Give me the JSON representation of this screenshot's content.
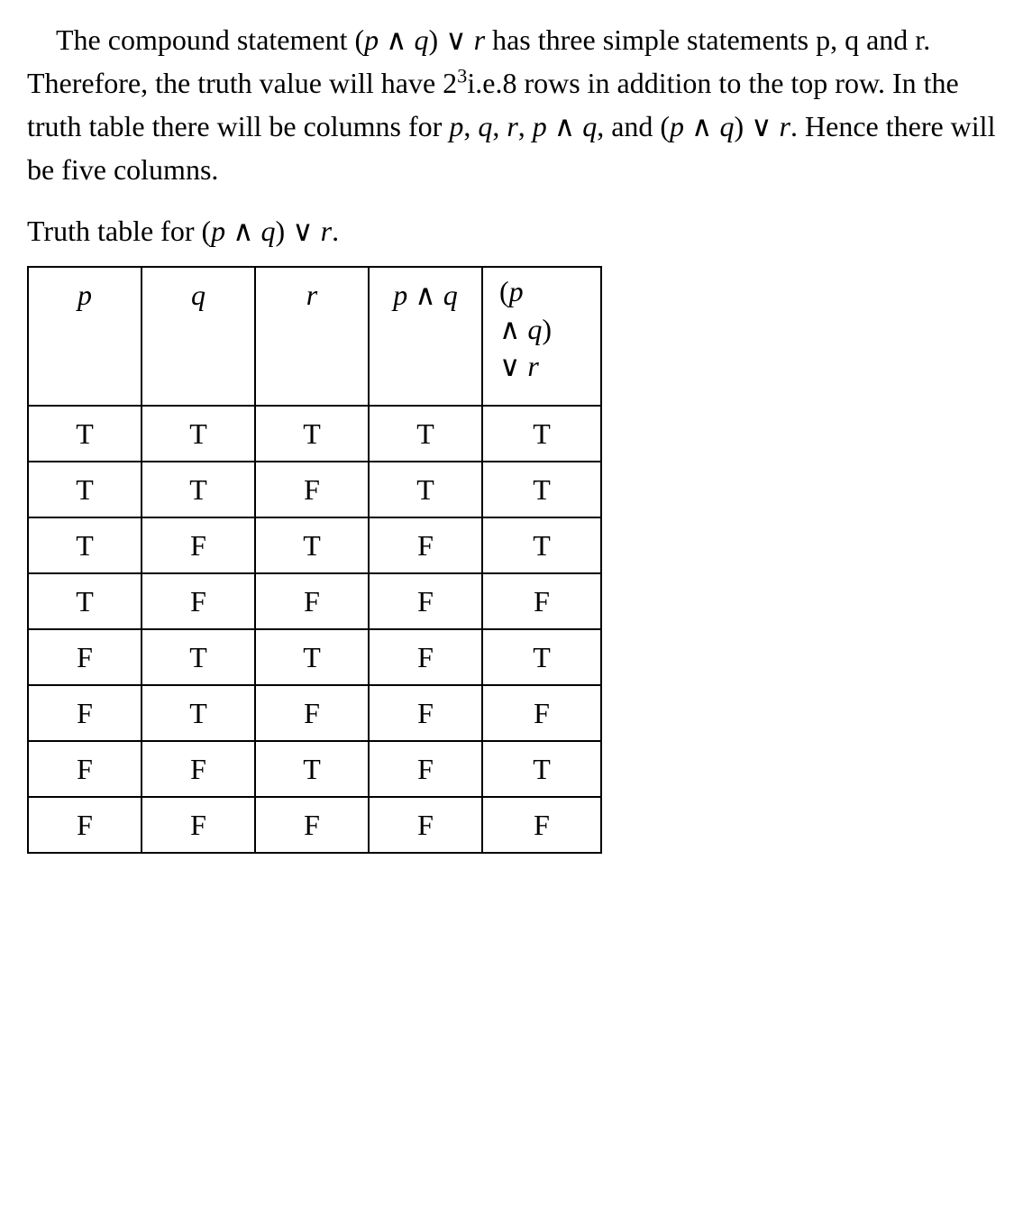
{
  "paragraph": {
    "text1": "The compound statement (",
    "expr1": "p",
    "op1": " ∧ ",
    "expr2": "q",
    "text2": ") ∨ ",
    "expr3": "r",
    "text3": " has three simple statements p, q and r. Therefore, the truth value will have 2",
    "exp": "3",
    "text4": "i.e.8 rows in addition to the top row. In the truth table there will be columns for ",
    "list_p": "p",
    "comma1": ", ",
    "list_q": "q",
    "comma2": ", ",
    "list_r": "r",
    "comma3": ", ",
    "list_pq": "p",
    "op2": " ∧ ",
    "list_pq2": "q",
    "comma4": ", and (",
    "list_final_p": "p",
    "op3": " ∧ ",
    "list_final_q": "q",
    "text5": ") ∨ ",
    "list_final_r": "r",
    "text6": ". Hence there will be five columns."
  },
  "caption": {
    "text1": "Truth table for (",
    "p": "p",
    "op1": " ∧ ",
    "q": "q",
    "text2": ") ∨ ",
    "r": "r",
    "period": "."
  },
  "headers": {
    "c1": "p",
    "c2": "q",
    "c3": "r",
    "c4_p": "p",
    "c4_op": " ∧ ",
    "c4_q": "q",
    "c5_line1_open": "(",
    "c5_line1_p": "p",
    "c5_line2_op": "∧ ",
    "c5_line2_q": "q",
    "c5_line2_close": ")",
    "c5_line3_op": "∨ ",
    "c5_line3_r": "r"
  },
  "rows": [
    {
      "p": "T",
      "q": "T",
      "r": "T",
      "pq": "T",
      "pqr": "T"
    },
    {
      "p": "T",
      "q": "T",
      "r": "F",
      "pq": "T",
      "pqr": "T"
    },
    {
      "p": "T",
      "q": "F",
      "r": "T",
      "pq": "F",
      "pqr": "T"
    },
    {
      "p": "T",
      "q": "F",
      "r": "F",
      "pq": "F",
      "pqr": "F"
    },
    {
      "p": "F",
      "q": "T",
      "r": "T",
      "pq": "F",
      "pqr": "T"
    },
    {
      "p": "F",
      "q": "T",
      "r": "F",
      "pq": "F",
      "pqr": "F"
    },
    {
      "p": "F",
      "q": "F",
      "r": "T",
      "pq": "F",
      "pqr": "T"
    },
    {
      "p": "F",
      "q": "F",
      "r": "F",
      "pq": "F",
      "pqr": "F"
    }
  ]
}
